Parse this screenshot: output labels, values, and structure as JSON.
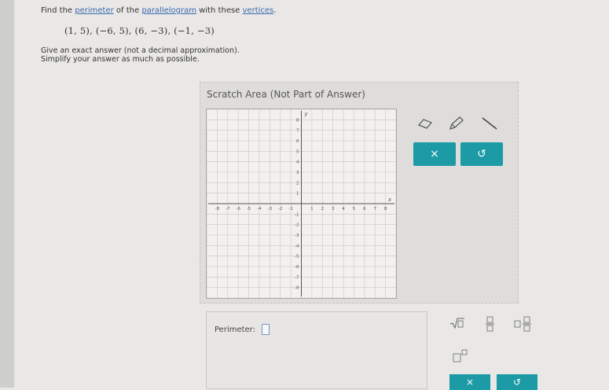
{
  "question": {
    "prefix": "Find the ",
    "link1": "perimeter",
    "middle": " of the ",
    "link2": "parallelogram",
    "middle2": " with these ",
    "link3": "vertices",
    "suffix": "."
  },
  "vertices_text": "(1, 5), (−6, 5), (6, −3), (−1, −3)",
  "instructions": {
    "line1": "Give an exact answer (not a decimal approximation).",
    "line2": "Simplify your answer as much as possible."
  },
  "scratch": {
    "title": "Scratch Area (Not Part of Answer)",
    "x_label": "x",
    "y_label": "y",
    "x_ticks": [
      "-8",
      "-7",
      "-6",
      "-5",
      "-4",
      "-3",
      "-2",
      "-1",
      "1",
      "2",
      "3",
      "4",
      "5",
      "6",
      "7",
      "8"
    ],
    "y_ticks": [
      "8",
      "7",
      "6",
      "5",
      "4",
      "3",
      "2",
      "1",
      "-1",
      "-2",
      "-3",
      "-4",
      "-5",
      "-6",
      "-7",
      "-8"
    ]
  },
  "tools": {
    "eraser_icon": "eraser-icon",
    "pencil_icon": "pencil-icon",
    "line_icon": "line-segment-icon",
    "clear_label": "×",
    "undo_label": "↺"
  },
  "answer": {
    "label": "Perimeter:",
    "value": ""
  },
  "math_tools": {
    "sqrt_icon": "square-root-icon",
    "fraction_icon": "fraction-icon",
    "mixed_number_icon": "mixed-number-icon",
    "exponent_icon": "exponent-icon"
  },
  "bottom_buttons": {
    "clear_label": "×",
    "undo_label": "↺"
  },
  "colors": {
    "accent": "#1c9aa6",
    "link": "#3b6bb0"
  }
}
